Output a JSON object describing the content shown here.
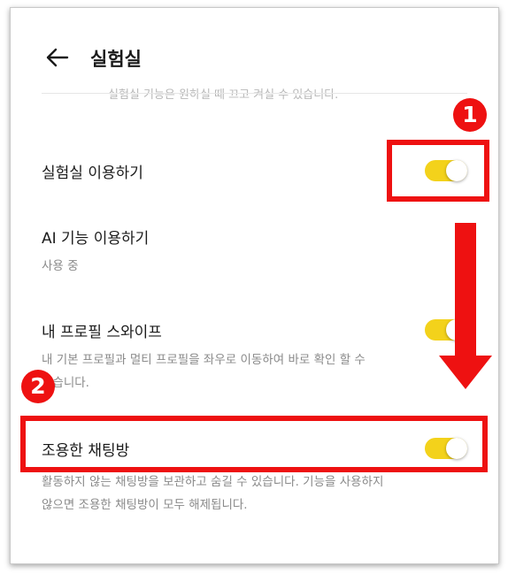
{
  "header": {
    "title": "실험실"
  },
  "lab_intro_description": "실험실 기능은 원하실 때 끄고 켜실 수 있습니다.",
  "settings": [
    {
      "title": "실험실 이용하기",
      "toggle": "on"
    },
    {
      "title": "AI 기능 이용하기",
      "status": "사용 중"
    },
    {
      "title": "내 프로필 스와이프",
      "description_1": "내 기본 프로필과 멀티 프로필을 좌우로 이동하여 바로 확인 할 수",
      "description_2": "있습니다.",
      "toggle": "on"
    },
    {
      "title": "조용한 채팅방",
      "description_1": "활동하지 않는 채팅방을 보관하고 숨길 수 있습니다. 기능을 사용하지",
      "description_2": "않으면 조용한 채팅방이 모두 해제됩니다.",
      "toggle": "on"
    }
  ],
  "annotations": {
    "badge_1": "1",
    "badge_2": "2",
    "highlight_color": "#ee1111"
  },
  "colors": {
    "toggle_on": "#f3d21b",
    "accent": "#ee1111"
  },
  "icons": {
    "back": "arrow-left-icon"
  }
}
